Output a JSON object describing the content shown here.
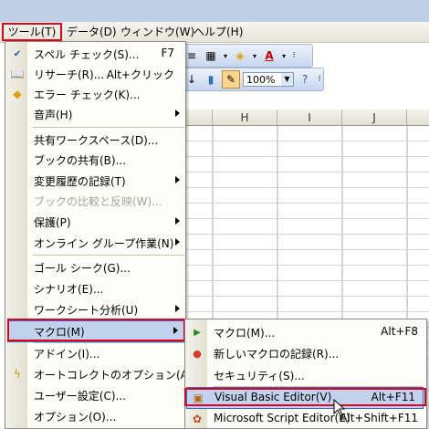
{
  "menubar": {
    "items": [
      "ツール(T)",
      "データ(D)",
      "ウィンドウ(W)",
      "ヘルプ(H)"
    ]
  },
  "toolbar": {
    "zoom": "100%"
  },
  "columns": [
    "H",
    "I",
    "J"
  ],
  "tools_menu": {
    "items": [
      {
        "label": "スペル チェック(S)...",
        "shortcut": "F7"
      },
      {
        "label": "リサーチ(R)...",
        "shortcut": "Alt+クリック"
      },
      {
        "label": "エラー チェック(K)..."
      },
      {
        "label": "音声(H)"
      },
      {
        "label": "共有ワークスペース(D)..."
      },
      {
        "label": "ブックの共有(B)..."
      },
      {
        "label": "変更履歴の記録(T)"
      },
      {
        "label": "ブックの比較と反映(W)..."
      },
      {
        "label": "保護(P)"
      },
      {
        "label": "オンライン グループ作業(N)"
      },
      {
        "label": "ゴール シーク(G)..."
      },
      {
        "label": "シナリオ(E)..."
      },
      {
        "label": "ワークシート分析(U)"
      },
      {
        "label": "マクロ(M)"
      },
      {
        "label": "アドイン(I)..."
      },
      {
        "label": "オートコレクトのオプション(A)..."
      },
      {
        "label": "ユーザー設定(C)..."
      },
      {
        "label": "オプション(O)..."
      }
    ]
  },
  "macro_submenu": {
    "items": [
      {
        "label": "マクロ(M)...",
        "shortcut": "Alt+F8"
      },
      {
        "label": "新しいマクロの記録(R)..."
      },
      {
        "label": "セキュリティ(S)..."
      },
      {
        "label": "Visual Basic Editor(V)",
        "shortcut": "Alt+F11"
      },
      {
        "label": "Microsoft Script Editor(E)",
        "shortcut": "Alt+Shift+F11"
      }
    ]
  },
  "colors": {
    "highlight_box": "#e0001b",
    "menu_selection": "#c1d2ee"
  }
}
